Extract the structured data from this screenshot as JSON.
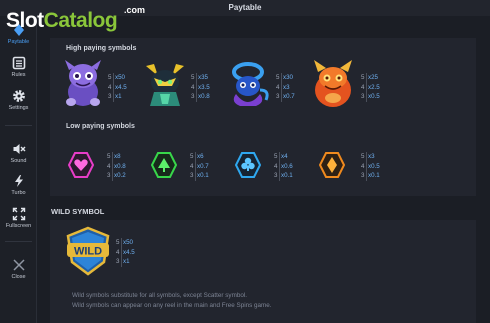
{
  "window": {
    "title": "Paytable"
  },
  "logo": {
    "part1": "Slot",
    "part2": "Catalog",
    "suffix": ".com"
  },
  "sidebar": {
    "items": [
      {
        "label": "Paytable",
        "icon": "paytable-icon",
        "active": true
      },
      {
        "label": "Rules",
        "icon": "list-icon"
      },
      {
        "label": "Settings",
        "icon": "gear-icon"
      },
      {
        "label": "Sound",
        "icon": "speaker-muted-icon"
      },
      {
        "label": "Turbo",
        "icon": "lightning-icon"
      },
      {
        "label": "Fullscreen",
        "icon": "fullscreen-icon"
      },
      {
        "label": "Close",
        "icon": "close-icon"
      }
    ]
  },
  "paytable": {
    "high_title": "High paying symbols",
    "high": [
      {
        "name": "purple-monster",
        "pays": [
          {
            "n": "5",
            "v": "x50"
          },
          {
            "n": "4",
            "v": "x4.5"
          },
          {
            "n": "3",
            "v": "x1"
          }
        ]
      },
      {
        "name": "green-monster",
        "pays": [
          {
            "n": "5",
            "v": "x35"
          },
          {
            "n": "4",
            "v": "x3.5"
          },
          {
            "n": "3",
            "v": "x0.8"
          }
        ]
      },
      {
        "name": "blue-monster",
        "pays": [
          {
            "n": "5",
            "v": "x30"
          },
          {
            "n": "4",
            "v": "x3"
          },
          {
            "n": "3",
            "v": "x0.7"
          }
        ]
      },
      {
        "name": "orange-monster",
        "pays": [
          {
            "n": "5",
            "v": "x25"
          },
          {
            "n": "4",
            "v": "x2.5"
          },
          {
            "n": "3",
            "v": "x0.5"
          }
        ]
      }
    ],
    "low_title": "Low paying symbols",
    "low": [
      {
        "name": "heart",
        "color": "#e83dc8",
        "pays": [
          {
            "n": "5",
            "v": "x8"
          },
          {
            "n": "4",
            "v": "x0.8"
          },
          {
            "n": "3",
            "v": "x0.2"
          }
        ]
      },
      {
        "name": "club",
        "color": "#38d64a",
        "pays": [
          {
            "n": "5",
            "v": "x6"
          },
          {
            "n": "4",
            "v": "x0.7"
          },
          {
            "n": "3",
            "v": "x0.1"
          }
        ]
      },
      {
        "name": "clover",
        "color": "#2fa8f0",
        "pays": [
          {
            "n": "5",
            "v": "x4"
          },
          {
            "n": "4",
            "v": "x0.6"
          },
          {
            "n": "3",
            "v": "x0.1"
          }
        ]
      },
      {
        "name": "diamond",
        "color": "#f08a1e",
        "pays": [
          {
            "n": "5",
            "v": "x3"
          },
          {
            "n": "4",
            "v": "x0.5"
          },
          {
            "n": "3",
            "v": "x0.1"
          }
        ]
      }
    ]
  },
  "wild": {
    "title": "WILD SYMBOL",
    "label": "WILD",
    "pays": [
      {
        "n": "5",
        "v": "x50"
      },
      {
        "n": "4",
        "v": "x4.5"
      },
      {
        "n": "3",
        "v": "x1"
      }
    ],
    "desc1": "Wild symbols substitute for all symbols, except Scatter symbol.",
    "desc2": "Wild symbols can appear on any reel in the main and Free Spins game."
  }
}
